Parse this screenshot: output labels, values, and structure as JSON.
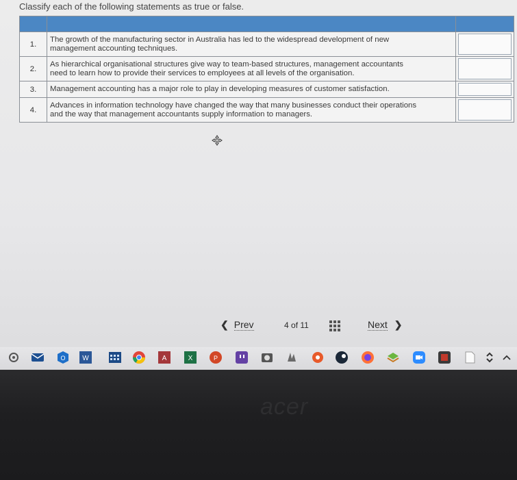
{
  "instruction": "Classify each of the following statements as true or false.",
  "statements": [
    {
      "num": "1.",
      "line1": "The growth of the manufacturing sector in Australia has led to the widespread development of new",
      "line2": "management accounting techniques."
    },
    {
      "num": "2.",
      "line1": "As hierarchical organisational structures give way to team-based structures, management accountants",
      "line2": "need to learn how to provide their services to employees at all levels of the organisation."
    },
    {
      "num": "3.",
      "line1": "Management accounting has a major role to play in developing measures of customer satisfaction.",
      "line2": ""
    },
    {
      "num": "4.",
      "line1": "Advances in information technology have changed the way that many businesses conduct their operations",
      "line2": "and the way that management accountants supply information to managers."
    }
  ],
  "pager": {
    "prev": "Prev",
    "current": "4",
    "of": "of",
    "total": "11",
    "next": "Next"
  },
  "brand": "acer",
  "colors": {
    "header_blue": "#4b87c4",
    "taskbar": "#e0e0e2",
    "bezel": "#1f1f21"
  },
  "taskbar_icons": [
    "settings-icon",
    "mail-icon",
    "outlook-icon",
    "word-icon",
    "calendar-icon",
    "chrome-icon",
    "access-icon",
    "excel-icon",
    "powerpoint-icon",
    "twitch-icon",
    "camera-icon",
    "hand-icon",
    "red-circle-icon",
    "steam-icon",
    "firefox-icon",
    "layers-icon",
    "zoom-icon",
    "app-icon",
    "document-icon",
    "chevron-updown-icon",
    "tray-up-icon"
  ]
}
